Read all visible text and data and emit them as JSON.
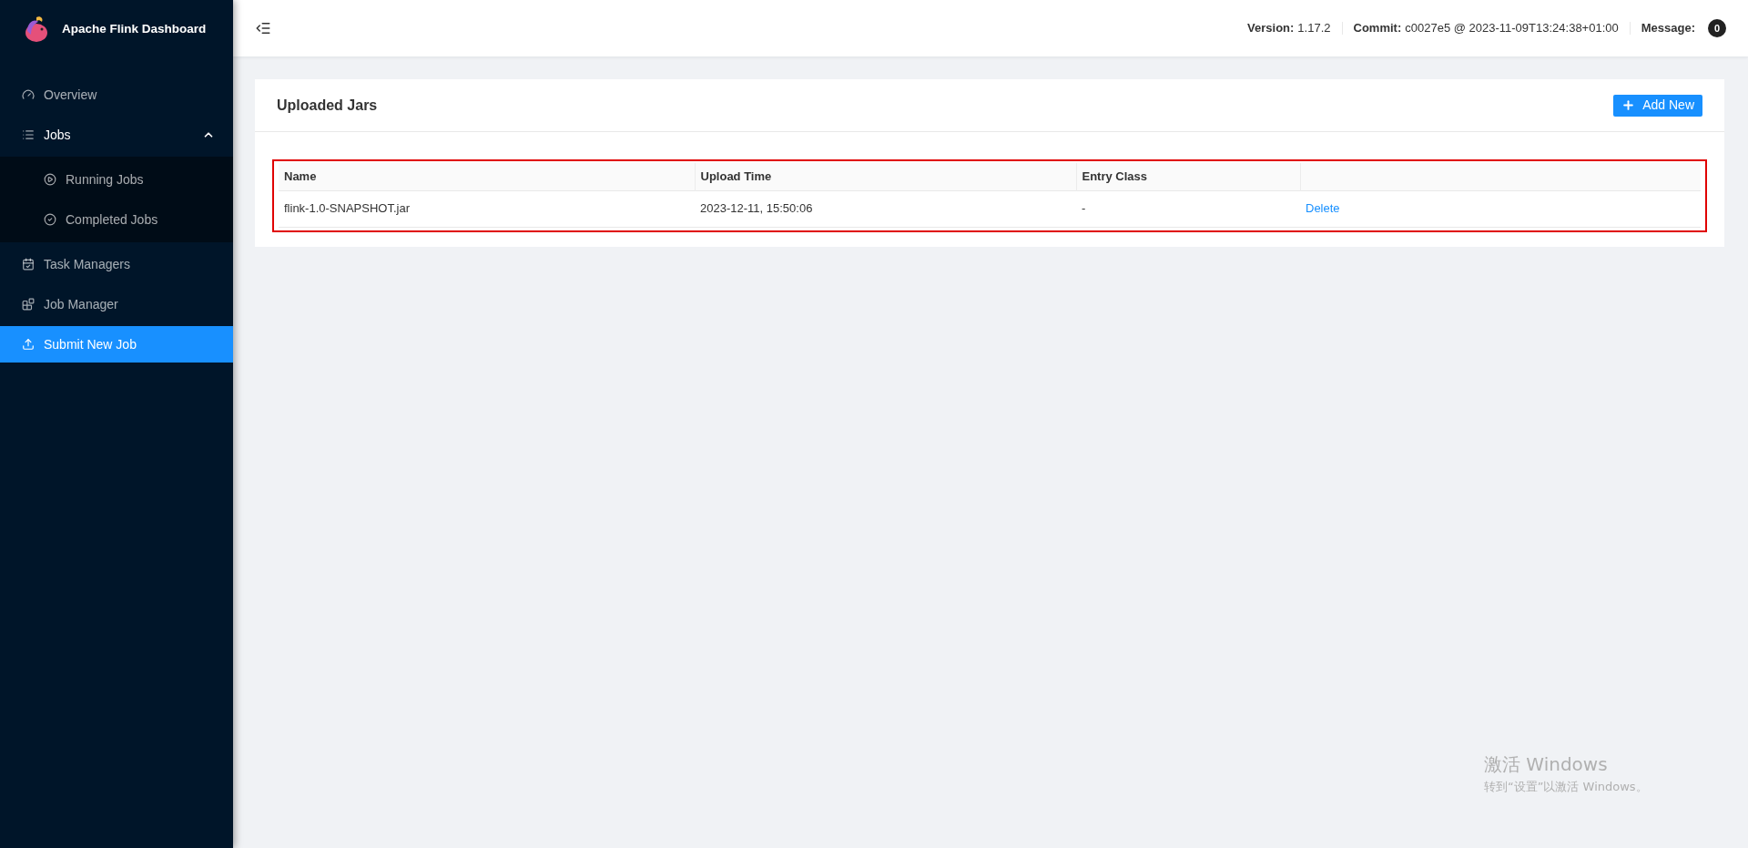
{
  "sidebar": {
    "title": "Apache Flink Dashboard",
    "items": [
      {
        "label": "Overview",
        "selected": false
      },
      {
        "label": "Jobs",
        "selected": false,
        "expanded": true,
        "children": [
          {
            "label": "Running Jobs",
            "selected": false
          },
          {
            "label": "Completed Jobs",
            "selected": false
          }
        ]
      },
      {
        "label": "Task Managers",
        "selected": false
      },
      {
        "label": "Job Manager",
        "selected": false
      },
      {
        "label": "Submit New Job",
        "selected": true
      }
    ]
  },
  "header": {
    "version_label": "Version:",
    "version": "1.17.2",
    "commit_label": "Commit:",
    "commit": "c0027e5 @ 2023-11-09T13:24:38+01:00",
    "message_label": "Message:",
    "message_count": "0"
  },
  "card": {
    "title": "Uploaded Jars",
    "add_button": "Add New",
    "table": {
      "columns": [
        "Name",
        "Upload Time",
        "Entry Class",
        ""
      ],
      "rows": [
        {
          "name": "flink-1.0-SNAPSHOT.jar",
          "upload_time": "2023-12-11, 15:50:06",
          "entry_class": "-",
          "action": "Delete"
        }
      ]
    }
  },
  "os_overlay": {
    "title": "激活 Windows",
    "subtitle": "转到“设置”以激活 Windows。"
  }
}
